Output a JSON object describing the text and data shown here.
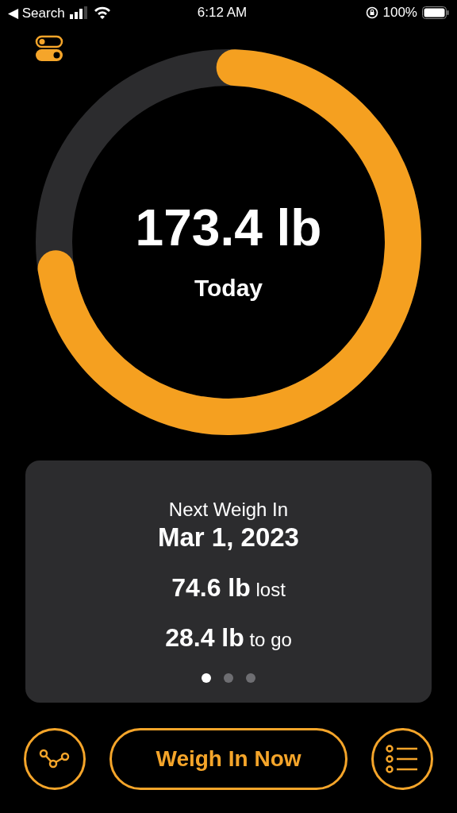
{
  "status_bar": {
    "back": "◀ Search",
    "time": "6:12 AM",
    "battery": "100%"
  },
  "ring": {
    "level": 0.72,
    "value": "173.4 lb",
    "label": "Today"
  },
  "card": {
    "title": "Next Weigh In",
    "date": "Mar 1, 2023",
    "stats": [
      "**74.6 lb** lost",
      "**28.4 lb** to go"
    ],
    "pages": [
      {
        "selected": true
      },
      {
        "selected": false
      },
      {
        "selected": false
      }
    ]
  },
  "main_button": "Weigh In Now"
}
